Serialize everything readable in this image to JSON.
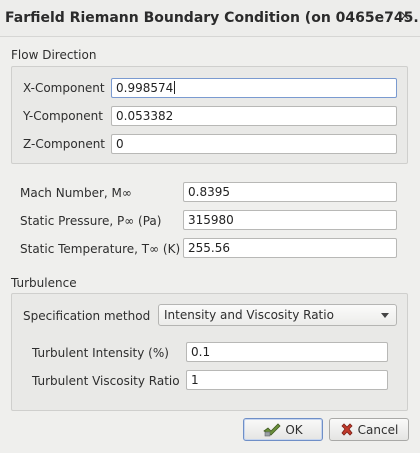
{
  "window": {
    "title": "Farfield Riemann Boundary Condition (on 0465e745...",
    "close_glyph": "×"
  },
  "flow_direction": {
    "heading": "Flow Direction",
    "x_label": "X-Component",
    "x_value": "0.998574",
    "y_label": "Y-Component",
    "y_value": "0.053382",
    "z_label": "Z-Component",
    "z_value": "0"
  },
  "freestream": {
    "mach_label": "Mach Number, M∞",
    "mach_value": "0.8395",
    "pressure_label": "Static Pressure, P∞ (Pa)",
    "pressure_value": "315980",
    "temperature_label": "Static Temperature, T∞ (K)",
    "temperature_value": "255.56"
  },
  "turbulence": {
    "heading": "Turbulence",
    "spec_label": "Specification method",
    "spec_value": "Intensity and Viscosity Ratio",
    "intensity_label": "Turbulent Intensity (%)",
    "intensity_value": "0.1",
    "viscosity_label": "Turbulent Viscosity Ratio",
    "viscosity_value": "1"
  },
  "buttons": {
    "ok_label": "OK",
    "cancel_label": "Cancel"
  },
  "icons": {
    "ok": "check-icon",
    "cancel": "cancel-x-icon",
    "close": "close-icon",
    "dropdown": "chevron-down-icon"
  },
  "colors": {
    "ok_check": "#6a8f3a",
    "cancel_x": "#c0392b",
    "focus_border": "#7a9ad0"
  }
}
